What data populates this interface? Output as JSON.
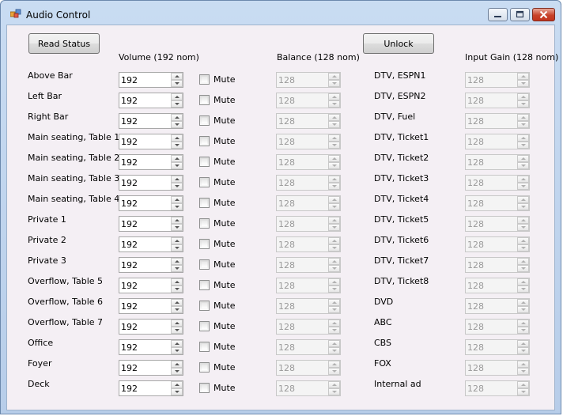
{
  "window": {
    "title": "Audio Control"
  },
  "buttons": {
    "read_status": "Read Status",
    "unlock": "Unlock"
  },
  "headers": {
    "volume": "Volume  (192 nom)",
    "balance": "Balance (128 nom)",
    "input_gain": "Input Gain (128 nom)"
  },
  "mute_label": "Mute",
  "zones": [
    {
      "name": "Above Bar",
      "volume": "192",
      "balance": "128"
    },
    {
      "name": "Left Bar",
      "volume": "192",
      "balance": "128"
    },
    {
      "name": "Right Bar",
      "volume": "192",
      "balance": "128"
    },
    {
      "name": "Main seating, Table 1",
      "volume": "192",
      "balance": "128"
    },
    {
      "name": "Main seating, Table 2",
      "volume": "192",
      "balance": "128"
    },
    {
      "name": "Main seating, Table 3",
      "volume": "192",
      "balance": "128"
    },
    {
      "name": "Main seating, Table 4",
      "volume": "192",
      "balance": "128"
    },
    {
      "name": "Private 1",
      "volume": "192",
      "balance": "128"
    },
    {
      "name": "Private 2",
      "volume": "192",
      "balance": "128"
    },
    {
      "name": "Private 3",
      "volume": "192",
      "balance": "128"
    },
    {
      "name": "Overflow, Table 5",
      "volume": "192",
      "balance": "128"
    },
    {
      "name": "Overflow, Table 6",
      "volume": "192",
      "balance": "128"
    },
    {
      "name": "Overflow, Table 7",
      "volume": "192",
      "balance": "128"
    },
    {
      "name": "Office",
      "volume": "192",
      "balance": "128"
    },
    {
      "name": "Foyer",
      "volume": "192",
      "balance": "128"
    },
    {
      "name": "Deck",
      "volume": "192",
      "balance": "128"
    }
  ],
  "inputs": [
    {
      "name": "DTV, ESPN1",
      "gain": "128"
    },
    {
      "name": "DTV, ESPN2",
      "gain": "128"
    },
    {
      "name": "DTV, Fuel",
      "gain": "128"
    },
    {
      "name": "DTV, Ticket1",
      "gain": "128"
    },
    {
      "name": "DTV, Ticket2",
      "gain": "128"
    },
    {
      "name": "DTV, Ticket3",
      "gain": "128"
    },
    {
      "name": "DTV, Ticket4",
      "gain": "128"
    },
    {
      "name": "DTV, Ticket5",
      "gain": "128"
    },
    {
      "name": "DTV, Ticket6",
      "gain": "128"
    },
    {
      "name": "DTV, Ticket7",
      "gain": "128"
    },
    {
      "name": "DTV, Ticket8",
      "gain": "128"
    },
    {
      "name": "DVD",
      "gain": "128"
    },
    {
      "name": "ABC",
      "gain": "128"
    },
    {
      "name": "CBS",
      "gain": "128"
    },
    {
      "name": "FOX",
      "gain": "128"
    },
    {
      "name": "Internal ad",
      "gain": "128"
    }
  ]
}
